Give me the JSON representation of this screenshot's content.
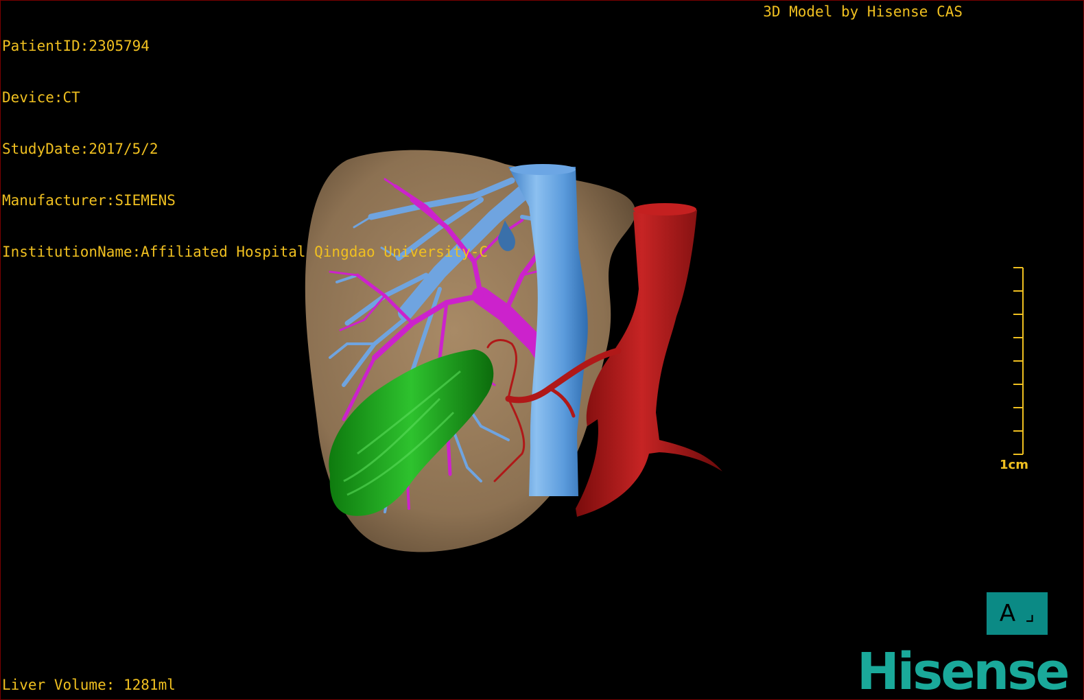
{
  "patient": {
    "id_line": "PatientID:2305794",
    "device_line": "Device:CT",
    "date_line": "StudyDate:2017/5/2",
    "manufacturer_line": "Manufacturer:SIEMENS",
    "institution_line": "InstitutionName:Affiliated Hospital Qingdao University-C"
  },
  "watermark": "3D Model by Hisense CAS",
  "volume_line": "Liver Volume: 1281ml",
  "scale": {
    "label": "1cm",
    "ticks": 8
  },
  "orientation": {
    "letter": "A",
    "mark": "⌟"
  },
  "logo": "Hisense",
  "colors": {
    "overlay_text": "#f0c020",
    "liver": "#9a8060",
    "portal_vein": "#6fa4e0",
    "hepatic_artery_branches": "#cc22cc",
    "gallbladder": "#18a018",
    "aorta": "#b01818",
    "ivc": "#5b9bdc",
    "orientation_button": "#0b8a85",
    "logo": "#1aa99a"
  }
}
